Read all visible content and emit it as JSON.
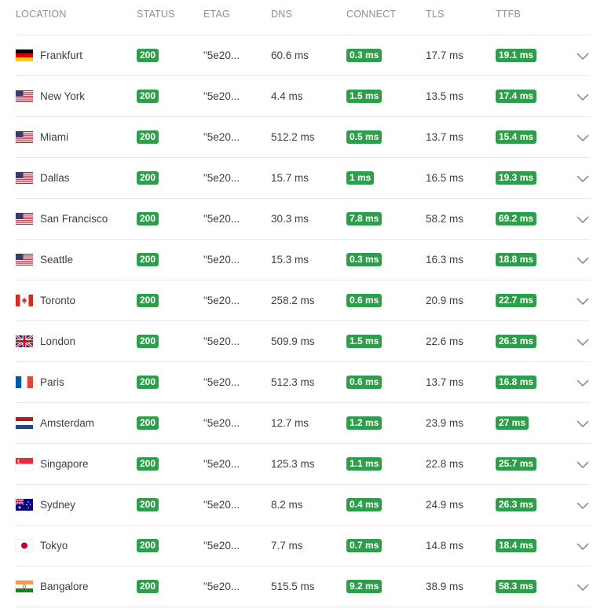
{
  "headers": {
    "location": "LOCATION",
    "status": "STATUS",
    "etag": "ETAG",
    "dns": "DNS",
    "connect": "CONNECT",
    "tls": "TLS",
    "ttfb": "TTFB"
  },
  "colors": {
    "badge_green": "#2e9e49",
    "header_text": "#8a9099",
    "row_border": "#e5e7eb"
  },
  "rows": [
    {
      "location": "Frankfurt",
      "flag": "de-flag-icon",
      "status": "200",
      "etag": "\"5e20...",
      "dns": "60.6 ms",
      "connect": "0.3 ms",
      "tls": "17.7 ms",
      "ttfb": "19.1 ms"
    },
    {
      "location": "New York",
      "flag": "us-flag-icon",
      "status": "200",
      "etag": "\"5e20...",
      "dns": "4.4 ms",
      "connect": "1.5 ms",
      "tls": "13.5 ms",
      "ttfb": "17.4 ms"
    },
    {
      "location": "Miami",
      "flag": "us-flag-icon",
      "status": "200",
      "etag": "\"5e20...",
      "dns": "512.2 ms",
      "connect": "0.5 ms",
      "tls": "13.7 ms",
      "ttfb": "15.4 ms"
    },
    {
      "location": "Dallas",
      "flag": "us-flag-icon",
      "status": "200",
      "etag": "\"5e20...",
      "dns": "15.7 ms",
      "connect": "1 ms",
      "tls": "16.5 ms",
      "ttfb": "19.3 ms"
    },
    {
      "location": "San Francisco",
      "flag": "us-flag-icon",
      "status": "200",
      "etag": "\"5e20...",
      "dns": "30.3 ms",
      "connect": "7.8 ms",
      "tls": "58.2 ms",
      "ttfb": "69.2 ms"
    },
    {
      "location": "Seattle",
      "flag": "us-flag-icon",
      "status": "200",
      "etag": "\"5e20...",
      "dns": "15.3 ms",
      "connect": "0.3 ms",
      "tls": "16.3 ms",
      "ttfb": "18.8 ms"
    },
    {
      "location": "Toronto",
      "flag": "ca-flag-icon",
      "status": "200",
      "etag": "\"5e20...",
      "dns": "258.2 ms",
      "connect": "0.6 ms",
      "tls": "20.9 ms",
      "ttfb": "22.7 ms"
    },
    {
      "location": "London",
      "flag": "gb-flag-icon",
      "status": "200",
      "etag": "\"5e20...",
      "dns": "509.9 ms",
      "connect": "1.5 ms",
      "tls": "22.6 ms",
      "ttfb": "26.3 ms"
    },
    {
      "location": "Paris",
      "flag": "fr-flag-icon",
      "status": "200",
      "etag": "\"5e20...",
      "dns": "512.3 ms",
      "connect": "0.6 ms",
      "tls": "13.7 ms",
      "ttfb": "16.8 ms"
    },
    {
      "location": "Amsterdam",
      "flag": "nl-flag-icon",
      "status": "200",
      "etag": "\"5e20...",
      "dns": "12.7 ms",
      "connect": "1.2 ms",
      "tls": "23.9 ms",
      "ttfb": "27 ms"
    },
    {
      "location": "Singapore",
      "flag": "sg-flag-icon",
      "status": "200",
      "etag": "\"5e20...",
      "dns": "125.3 ms",
      "connect": "1.1 ms",
      "tls": "22.8 ms",
      "ttfb": "25.7 ms"
    },
    {
      "location": "Sydney",
      "flag": "au-flag-icon",
      "status": "200",
      "etag": "\"5e20...",
      "dns": "8.2 ms",
      "connect": "0.4 ms",
      "tls": "24.9 ms",
      "ttfb": "26.3 ms"
    },
    {
      "location": "Tokyo",
      "flag": "jp-flag-icon",
      "status": "200",
      "etag": "\"5e20...",
      "dns": "7.7 ms",
      "connect": "0.7 ms",
      "tls": "14.8 ms",
      "ttfb": "18.4 ms"
    },
    {
      "location": "Bangalore",
      "flag": "in-flag-icon",
      "status": "200",
      "etag": "\"5e20...",
      "dns": "515.5 ms",
      "connect": "9.2 ms",
      "tls": "38.9 ms",
      "ttfb": "58.3 ms"
    }
  ]
}
